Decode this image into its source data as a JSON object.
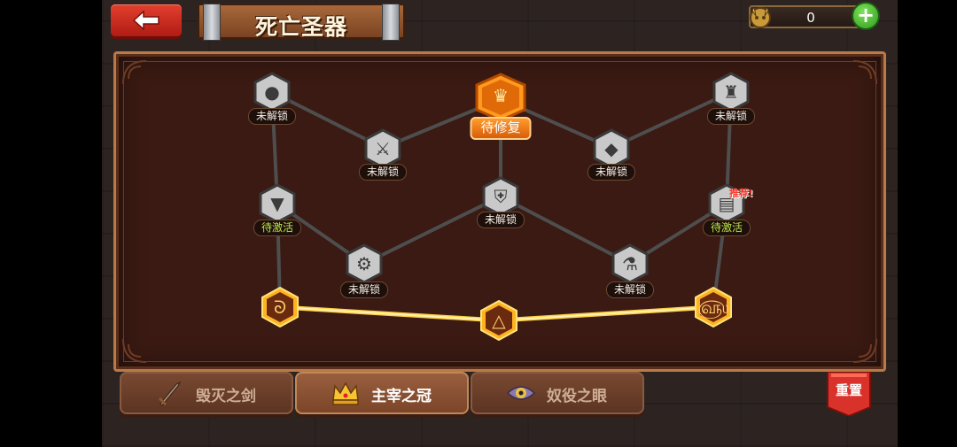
{
  "header": {
    "back_icon": "arrow-left-icon",
    "title": "死亡圣器"
  },
  "currency": {
    "icon": "demon-coin-icon",
    "value": "0",
    "add_icon": "plus-icon",
    "add_label": "+"
  },
  "tree": {
    "nodes": [
      {
        "id": "n1",
        "icon": "cookie-icon",
        "label": "未解锁",
        "state": "locked"
      },
      {
        "id": "n2",
        "icon": "sword-slash-icon",
        "label": "未解锁",
        "state": "locked"
      },
      {
        "id": "n3",
        "icon": "crown-icon",
        "label": "待修复",
        "state": "repair"
      },
      {
        "id": "n4",
        "icon": "gem-icon",
        "label": "未解锁",
        "state": "locked"
      },
      {
        "id": "n5",
        "icon": "castle-icon",
        "label": "未解锁",
        "state": "locked"
      },
      {
        "id": "n6",
        "icon": "anvil-icon",
        "label": "待激活",
        "state": "pending"
      },
      {
        "id": "n7",
        "icon": "shield-sword-icon",
        "label": "未解锁",
        "state": "locked"
      },
      {
        "id": "n8",
        "icon": "card-icon",
        "label": "待激活",
        "state": "pending",
        "badge": "推荐!"
      },
      {
        "id": "n9",
        "icon": "gear-icon",
        "label": "未解锁",
        "state": "locked"
      },
      {
        "id": "n10",
        "icon": "potion-icon",
        "label": "未解锁",
        "state": "locked"
      },
      {
        "id": "r1",
        "icon": "rune-swirl-icon",
        "state": "active"
      },
      {
        "id": "r2",
        "icon": "rune-triangle-icon",
        "state": "active"
      },
      {
        "id": "r3",
        "icon": "rune-spiral-icon",
        "state": "active"
      }
    ]
  },
  "tabs": [
    {
      "label": "毁灭之剑",
      "icon": "sword-icon",
      "active": false
    },
    {
      "label": "主宰之冠",
      "icon": "crown-icon",
      "active": true
    },
    {
      "label": "奴役之眼",
      "icon": "eye-icon",
      "active": false
    }
  ],
  "reset": {
    "label": "重置"
  }
}
